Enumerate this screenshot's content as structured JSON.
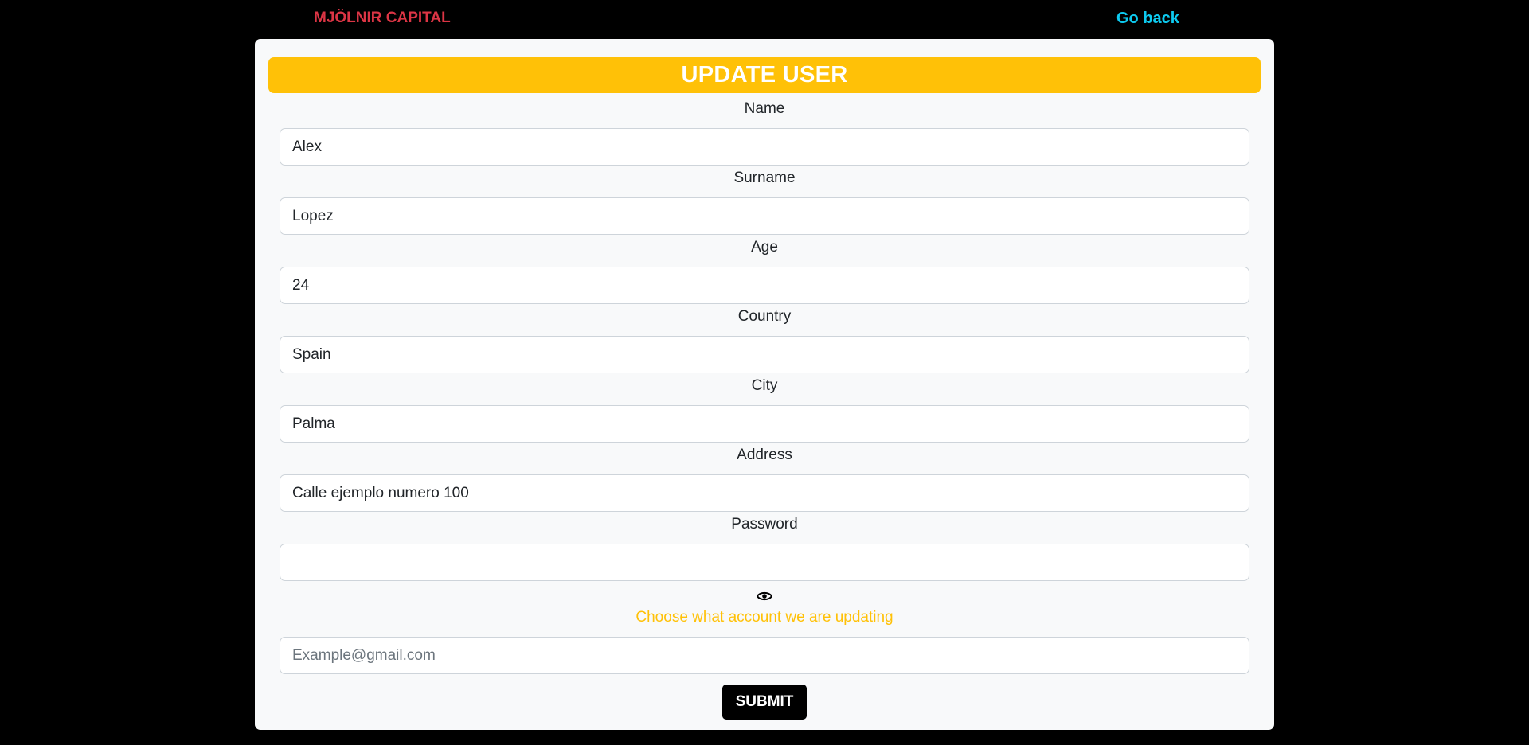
{
  "nav": {
    "brand": "MJÖLNIR CAPITAL",
    "go_back": "Go back"
  },
  "form": {
    "title": "UPDATE USER",
    "fields": [
      {
        "label": "Name",
        "value": "Alex"
      },
      {
        "label": "Surname",
        "value": "Lopez"
      },
      {
        "label": "Age",
        "value": "24"
      },
      {
        "label": "Country",
        "value": "Spain"
      },
      {
        "label": "City",
        "value": "Palma"
      },
      {
        "label": "Address",
        "value": "Calle ejemplo numero 100"
      },
      {
        "label": "Password",
        "value": ""
      }
    ],
    "toggle_icon": "eye-icon",
    "account_hint": "Choose what account we are updating",
    "email_placeholder": "Example@gmail.com",
    "submit_label": "SUBMIT"
  },
  "colors": {
    "background": "#000000",
    "brand": "#dc3545",
    "link": "#0dcaf0",
    "header": "#ffc107",
    "card": "#f8f9fa"
  }
}
